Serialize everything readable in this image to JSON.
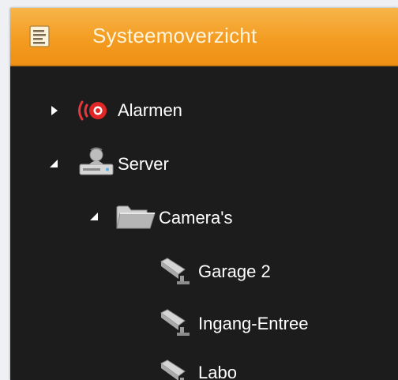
{
  "panel": {
    "title": "Systeemoverzicht",
    "header_icon": "list-document-icon",
    "accent_color": "#f39a1f"
  },
  "tree": {
    "alarms": {
      "label": "Alarmen",
      "icon": "alarm-icon",
      "expanded": false
    },
    "server": {
      "label": "Server",
      "icon": "server-user-icon",
      "expanded": true
    },
    "cameras": {
      "label": "Camera's",
      "icon": "folder-icon",
      "expanded": true
    },
    "camera_items": [
      {
        "label": "Garage 2",
        "icon": "security-camera-icon"
      },
      {
        "label": "Ingang-Entree",
        "icon": "security-camera-icon"
      },
      {
        "label": "Labo",
        "icon": "security-camera-icon"
      }
    ]
  }
}
